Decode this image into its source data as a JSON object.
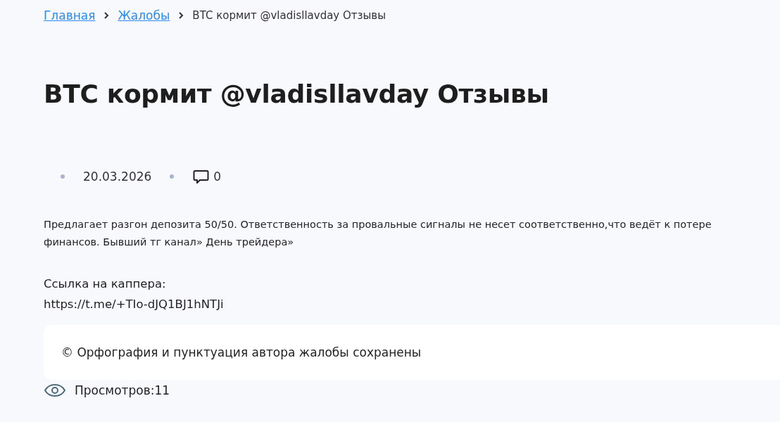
{
  "breadcrumbs": [
    {
      "label": "Главная",
      "kind": "link"
    },
    {
      "label": "Жалобы",
      "kind": "link"
    },
    {
      "label": "BTC кормит @vladisllavday Отзывы",
      "kind": "current"
    }
  ],
  "title": "BTC кормит @vladisllavday Отзывы",
  "meta": {
    "date": "20.03.2026",
    "comments": "0"
  },
  "body": "Предлагает разгон депозита 50/50. Ответственность за провальные сигналы не несет соответственно,что ведёт к потере финансов. Бывший тг канал» День трейдера»",
  "link_label": "Ссылка на каппера:",
  "link_url": "https://t.me/+TIo-dJQ1BJ1hNTJi",
  "notice": "© Орфография и пунктуация автора жалобы сохранены",
  "views": "Просмотров:11"
}
